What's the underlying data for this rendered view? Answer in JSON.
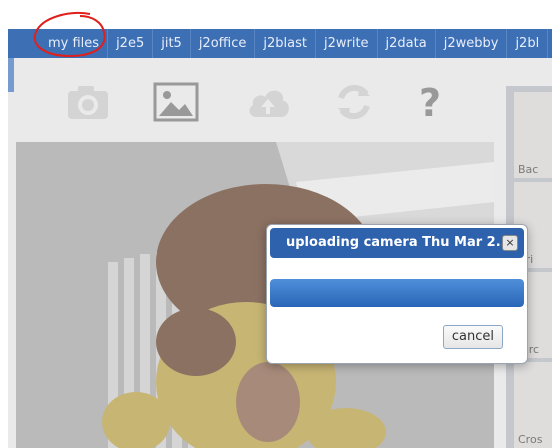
{
  "nav": {
    "tabs": [
      "my files",
      "j2e5",
      "jit5",
      "j2office",
      "j2blast",
      "j2write",
      "j2data",
      "j2webby",
      "j2bl"
    ]
  },
  "toolbar": {
    "icons": [
      "camera-icon",
      "image-icon",
      "cloud-upload-icon",
      "refresh-icon",
      "help-icon"
    ]
  },
  "thumbnails": [
    {
      "label": "Bac"
    },
    {
      "label": "Bri"
    },
    {
      "label": "Circ"
    },
    {
      "label": "Cros"
    }
  ],
  "dialog": {
    "title": "uploading camera Thu Mar 2...",
    "close_label": "×",
    "progress": 1.0,
    "cancel_label": "cancel"
  },
  "colors": {
    "nav_bg": "#3d6fb5",
    "dialog_title_bg": "#2e62ad",
    "progress_fill": "#2a66b8",
    "annotation": "#e0201c"
  }
}
